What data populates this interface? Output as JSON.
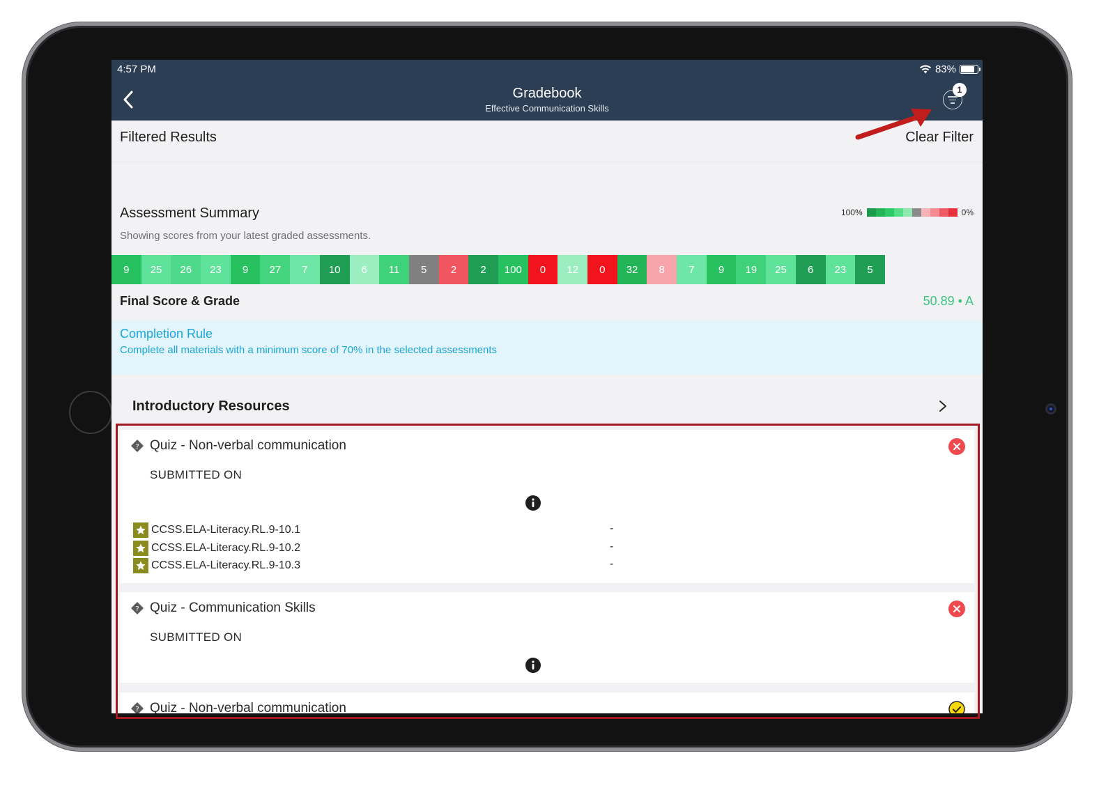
{
  "status_bar": {
    "time": "4:57 PM",
    "battery": "83%",
    "battery_level": 0.83
  },
  "header": {
    "title": "Gradebook",
    "subtitle": "Effective Communication Skills",
    "filter_count": "1",
    "back_icon": "chevron-left-icon",
    "filter_icon": "filter-icon"
  },
  "filter_row": {
    "label": "Filtered Results",
    "clear_label": "Clear Filter"
  },
  "summary": {
    "title": "Assessment Summary",
    "subtitle": "Showing scores from your latest graded assessments.",
    "legend_high": "100%",
    "legend_low": "0%",
    "legend_colors": [
      "#1a9a4a",
      "#22b457",
      "#2ccb66",
      "#55dd87",
      "#8fe8b0",
      "#8a8a8a",
      "#f7b4b8",
      "#f58a90",
      "#f05a63",
      "#e8313c"
    ]
  },
  "scores": [
    {
      "value": "9",
      "color": "#27c160"
    },
    {
      "value": "25",
      "color": "#5fe39a"
    },
    {
      "value": "26",
      "color": "#4fd98a"
    },
    {
      "value": "23",
      "color": "#5fe39a"
    },
    {
      "value": "9",
      "color": "#27c160"
    },
    {
      "value": "27",
      "color": "#45d57f"
    },
    {
      "value": "7",
      "color": "#6ee6a5"
    },
    {
      "value": "10",
      "color": "#1f9e54"
    },
    {
      "value": "6",
      "color": "#9aeec0"
    },
    {
      "value": "11",
      "color": "#3fd27a"
    },
    {
      "value": "5",
      "color": "#808080"
    },
    {
      "value": "2",
      "color": "#f05560"
    },
    {
      "value": "2",
      "color": "#1f9e54"
    },
    {
      "value": "100",
      "color": "#27c160"
    },
    {
      "value": "0",
      "color": "#f2141c"
    },
    {
      "value": "12",
      "color": "#9aeec0"
    },
    {
      "value": "0",
      "color": "#f2141c"
    },
    {
      "value": "32",
      "color": "#22b457"
    },
    {
      "value": "8",
      "color": "#f7a5aa"
    },
    {
      "value": "7",
      "color": "#6ee6a5"
    },
    {
      "value": "9",
      "color": "#27c160"
    },
    {
      "value": "19",
      "color": "#3fd27a"
    },
    {
      "value": "25",
      "color": "#5fe39a"
    },
    {
      "value": "6",
      "color": "#1f9e54"
    },
    {
      "value": "23",
      "color": "#5fe39a"
    },
    {
      "value": "5",
      "color": "#1f9e54"
    }
  ],
  "final": {
    "label": "Final Score & Grade",
    "value": "50.89 • A"
  },
  "completion_rule": {
    "title": "Completion Rule",
    "text": "Complete all materials with a minimum score of 70% in the selected assessments"
  },
  "section": {
    "title": "Introductory Resources",
    "chevron_icon": "chevron-right-icon"
  },
  "items": [
    {
      "title": "Quiz - Non-verbal communication",
      "status": "SUBMITTED ON",
      "status_icon": "close-icon",
      "standards": [
        {
          "label": "CCSS.ELA-Literacy.RL.9-10.1",
          "score": "-"
        },
        {
          "label": "CCSS.ELA-Literacy.RL.9-10.2",
          "score": "-"
        },
        {
          "label": "CCSS.ELA-Literacy.RL.9-10.3",
          "score": "-"
        }
      ]
    },
    {
      "title": "Quiz - Communication Skills",
      "status": "SUBMITTED ON",
      "status_icon": "close-icon"
    },
    {
      "title": "Quiz - Non-verbal communication",
      "status_icon": "check-pending-icon"
    }
  ],
  "colors": {
    "header_bg": "#2c3e54",
    "accent_blue": "#1aa6d6",
    "grade_green": "#3cc582",
    "error_red": "#f04a4e",
    "highlight": "#a31821"
  }
}
